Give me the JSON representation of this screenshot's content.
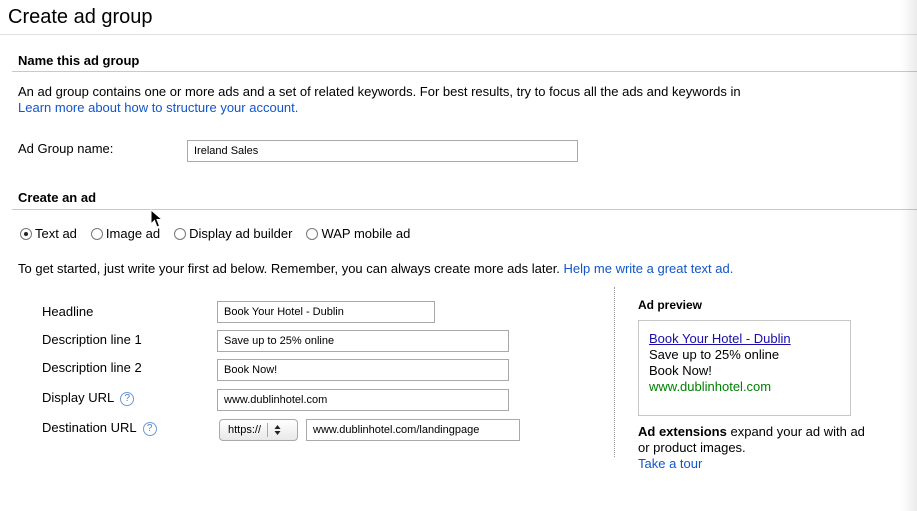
{
  "page_title": "Create ad group",
  "name_section": {
    "heading": "Name this ad group",
    "intro_text": "An ad group contains one or more ads and a set of related keywords. For best results, try to focus all the ads and keywords in",
    "learn_more_link": "Learn more about how to structure your account.",
    "ad_group_name_label": "Ad Group name:",
    "ad_group_name_value": "Ireland Sales"
  },
  "create_ad_section": {
    "heading": "Create an ad",
    "ad_types": [
      {
        "label": "Text ad",
        "selected": true
      },
      {
        "label": "Image ad",
        "selected": false
      },
      {
        "label": "Display ad builder",
        "selected": false
      },
      {
        "label": "WAP mobile ad",
        "selected": false
      }
    ],
    "instructions": "To get started, just write your first ad below. Remember, you can always create more ads later.",
    "help_link": "Help me write a great text ad."
  },
  "ad_form": {
    "headline_label": "Headline",
    "headline_value": "Book Your Hotel - Dublin",
    "desc1_label": "Description line 1",
    "desc1_value": "Save up to 25% online",
    "desc2_label": "Description line 2",
    "desc2_value": "Book Now!",
    "display_url_label": "Display URL",
    "display_url_value": "www.dublinhotel.com",
    "dest_url_label": "Destination URL",
    "protocol_value": "https://",
    "dest_url_value": "www.dublinhotel.com/landingpage",
    "help_icon_glyph": "?"
  },
  "preview": {
    "heading": "Ad preview",
    "headline": "Book Your Hotel - Dublin",
    "line1": "Save up to 25% online",
    "line2": "Book Now!",
    "url": "www.dublinhotel.com",
    "extensions_bold": "Ad extensions",
    "extensions_text_1": "expand your ad with ad",
    "extensions_text_2": "or product images.",
    "tour_link": "Take a tour"
  },
  "colors": {
    "link": "#1155cc",
    "preview_url": "#008000",
    "rule": "#c9c9c9"
  }
}
